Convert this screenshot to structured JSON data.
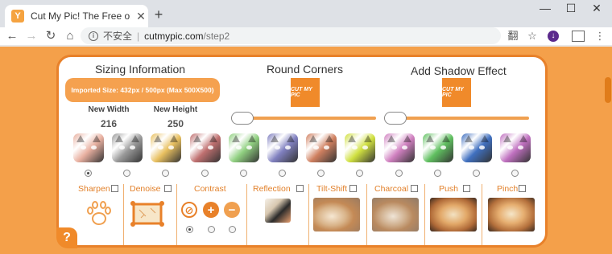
{
  "browser": {
    "tab_title": "Cut My Pic! The Free online ima",
    "favicon_letter": "Y",
    "new_tab": "+",
    "url_security": "不安全",
    "url_host": "cutmypic.com",
    "url_path": "/step2",
    "window_controls": {
      "minimize": "—",
      "maximize": "☐",
      "close": "✕"
    },
    "tab_close": "✕",
    "nav": {
      "back": "←",
      "forward": "→",
      "reload": "↻",
      "home": "⌂"
    },
    "toolbar_icons": {
      "translate": "翻",
      "bookmark": "☆",
      "download": "↓",
      "menu": "⋮"
    }
  },
  "page": {
    "sizing": {
      "title": "Sizing Information",
      "imported_size": "Imported Size: 432px / 500px (Max 500X500)",
      "new_width_label": "New Width",
      "new_width_value": "216",
      "new_height_label": "New Height",
      "new_height_value": "250"
    },
    "round_corners": {
      "title": "Round Corners",
      "logo_text": "CUT MY PIC",
      "slider_value": 0
    },
    "shadow": {
      "title": "Add Shadow Effect",
      "logo_text": "CUT MY PIC",
      "slider_value": 0
    },
    "color_filters": {
      "selected_index": 0,
      "tints": [
        "#e8b0a0",
        "#9a9a9a",
        "#e8c060",
        "#c07070",
        "#90d080",
        "#8080c0",
        "#d08060",
        "#d0e040",
        "#d080c0",
        "#60c060",
        "#4070c0",
        "#c070c0"
      ]
    },
    "effects": {
      "sharpen": "Sharpen",
      "denoise": "Denoise",
      "contrast": "Contrast",
      "contrast_selected_index": 0,
      "reflection": "Reflection",
      "tilt_shift": "Tilt-Shift",
      "charcoal": "Charcoal",
      "push": "Push",
      "pinch": "Pinch"
    },
    "help": "?"
  }
}
